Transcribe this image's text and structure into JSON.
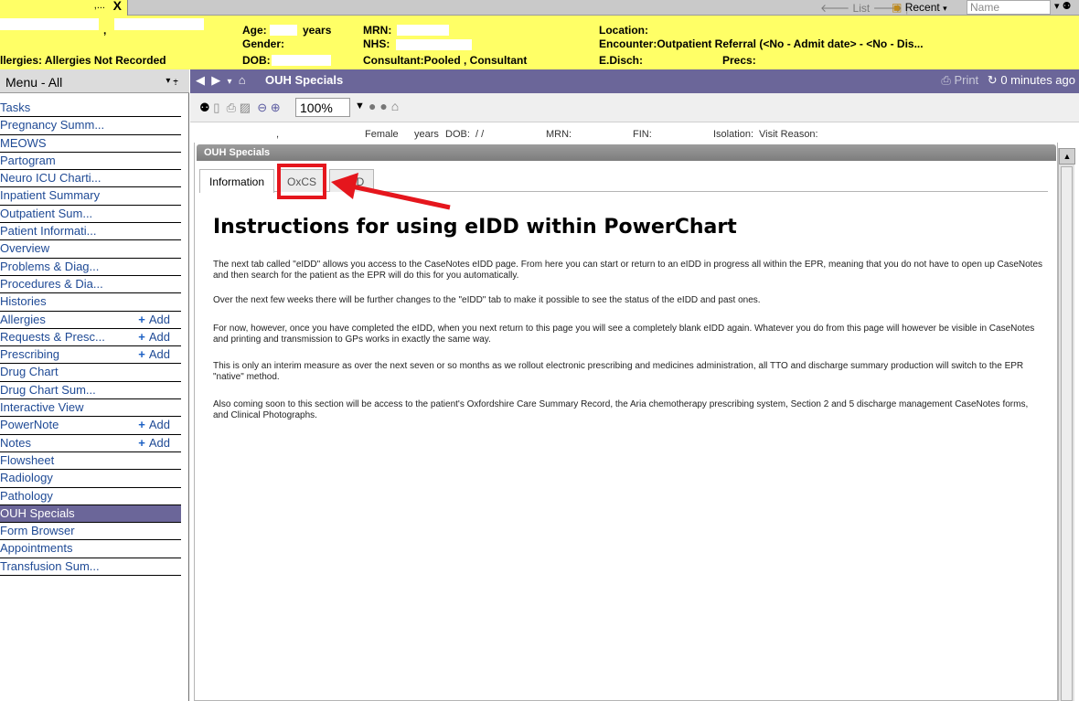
{
  "topbar": {
    "tab_dots": ",...",
    "tab_close": "X",
    "list_label": "List",
    "recent_label": "Recent",
    "name_placeholder": "Name"
  },
  "banner": {
    "age_label": "Age:",
    "age_unit": "years",
    "gender_label": "Gender:",
    "dob_label": "DOB:",
    "mrn_label": "MRN:",
    "nhs_label": "NHS:",
    "consultant": "Consultant:Pooled , Consultant",
    "location_label": "Location:",
    "encounter": "Encounter:Outpatient Referral (<No - Admit date> - <No - Dis...",
    "edisch_label": "E.Disch:",
    "precs_label": "Precs:",
    "allergies": "llergies: Allergies Not Recorded",
    "name_comma": ","
  },
  "sidebar": {
    "menu_label": "Menu - All",
    "add_label": "Add",
    "items": [
      {
        "label": "Tasks"
      },
      {
        "label": "Pregnancy Summ..."
      },
      {
        "label": "MEOWS"
      },
      {
        "label": "Partogram"
      },
      {
        "label": "Neuro ICU Charti..."
      },
      {
        "label": "Inpatient Summary"
      },
      {
        "label": "Outpatient Sum..."
      },
      {
        "label": "Patient Informati..."
      },
      {
        "label": "Overview"
      },
      {
        "label": "Problems & Diag..."
      },
      {
        "label": "Procedures & Dia..."
      },
      {
        "label": "Histories"
      },
      {
        "label": "Allergies"
      },
      {
        "label": "Requests & Presc..."
      },
      {
        "label": "Prescribing"
      },
      {
        "label": "Drug Chart"
      },
      {
        "label": "Drug Chart Sum..."
      },
      {
        "label": "Interactive View"
      },
      {
        "label": "PowerNote"
      },
      {
        "label": "Notes"
      },
      {
        "label": "Flowsheet"
      },
      {
        "label": "Radiology"
      },
      {
        "label": "Pathology"
      },
      {
        "label": "OUH Specials"
      },
      {
        "label": "Form Browser"
      },
      {
        "label": "Appointments"
      },
      {
        "label": "Transfusion Sum..."
      }
    ]
  },
  "navbar": {
    "title": "OUH Specials",
    "print_label": "Print",
    "refresh_label": "0 minutes ago"
  },
  "toolbar": {
    "zoom": "100%"
  },
  "patient_strip": {
    "comma": ",",
    "gender": "Female",
    "years": "years",
    "dob": "DOB:",
    "dob_slashes": "/   /",
    "mrn": "MRN:",
    "fin": "FIN:",
    "isolation": "Isolation:",
    "visit_reason": "Visit Reason:"
  },
  "panel": {
    "title": "OUH Specials",
    "tabs": [
      {
        "label": "Information"
      },
      {
        "label": "OxCS"
      },
      {
        "label": "eIDD"
      }
    ],
    "heading": "Instructions for using eIDD within PowerChart",
    "paragraphs": [
      "The next tab called \"eIDD\" allows you access to the CaseNotes eIDD page. From here you can start or return to an eIDD in progress all within the EPR, meaning that you do not have to open up CaseNotes and then search for the patient as the EPR will do this for you automatically.",
      "Over the next few weeks there will be further changes to the \"eIDD\" tab to make it possible to see the status of the eIDD and past ones.",
      "For now, however, once you have completed the eIDD, when you next return to this page you will see a completely blank eIDD again. Whatever you do from this page will however be visible in CaseNotes and printing and transmission to GPs works in exactly the same way.",
      "This is only an interim measure as over the next seven or so months as we rollout electronic prescribing and medicines administration, all TTO and discharge summary production will switch to the EPR \"native\" method.",
      "Also coming soon to this section will be access to the patient's Oxfordshire Care Summary Record, the Aria chemotherapy prescribing system, Section 2 and 5 discharge management CaseNotes forms, and Clinical Photographs."
    ]
  },
  "colors": {
    "banner": "#ffff66",
    "nav": "#6b6699",
    "link": "#1f4a95",
    "highlight": "#e5161d"
  }
}
